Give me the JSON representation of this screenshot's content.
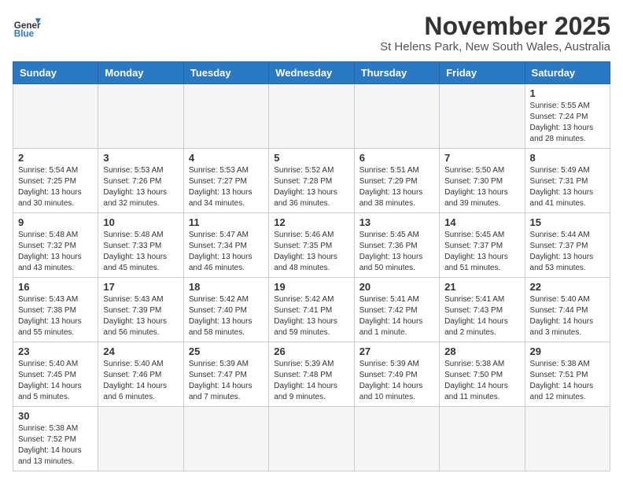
{
  "logo": {
    "text_general": "General",
    "text_blue": "Blue"
  },
  "title": "November 2025",
  "location": "St Helens Park, New South Wales, Australia",
  "weekdays": [
    "Sunday",
    "Monday",
    "Tuesday",
    "Wednesday",
    "Thursday",
    "Friday",
    "Saturday"
  ],
  "weeks": [
    [
      {
        "day": "",
        "info": ""
      },
      {
        "day": "",
        "info": ""
      },
      {
        "day": "",
        "info": ""
      },
      {
        "day": "",
        "info": ""
      },
      {
        "day": "",
        "info": ""
      },
      {
        "day": "",
        "info": ""
      },
      {
        "day": "1",
        "info": "Sunrise: 5:55 AM\nSunset: 7:24 PM\nDaylight: 13 hours\nand 28 minutes."
      }
    ],
    [
      {
        "day": "2",
        "info": "Sunrise: 5:54 AM\nSunset: 7:25 PM\nDaylight: 13 hours\nand 30 minutes."
      },
      {
        "day": "3",
        "info": "Sunrise: 5:53 AM\nSunset: 7:26 PM\nDaylight: 13 hours\nand 32 minutes."
      },
      {
        "day": "4",
        "info": "Sunrise: 5:53 AM\nSunset: 7:27 PM\nDaylight: 13 hours\nand 34 minutes."
      },
      {
        "day": "5",
        "info": "Sunrise: 5:52 AM\nSunset: 7:28 PM\nDaylight: 13 hours\nand 36 minutes."
      },
      {
        "day": "6",
        "info": "Sunrise: 5:51 AM\nSunset: 7:29 PM\nDaylight: 13 hours\nand 38 minutes."
      },
      {
        "day": "7",
        "info": "Sunrise: 5:50 AM\nSunset: 7:30 PM\nDaylight: 13 hours\nand 39 minutes."
      },
      {
        "day": "8",
        "info": "Sunrise: 5:49 AM\nSunset: 7:31 PM\nDaylight: 13 hours\nand 41 minutes."
      }
    ],
    [
      {
        "day": "9",
        "info": "Sunrise: 5:48 AM\nSunset: 7:32 PM\nDaylight: 13 hours\nand 43 minutes."
      },
      {
        "day": "10",
        "info": "Sunrise: 5:48 AM\nSunset: 7:33 PM\nDaylight: 13 hours\nand 45 minutes."
      },
      {
        "day": "11",
        "info": "Sunrise: 5:47 AM\nSunset: 7:34 PM\nDaylight: 13 hours\nand 46 minutes."
      },
      {
        "day": "12",
        "info": "Sunrise: 5:46 AM\nSunset: 7:35 PM\nDaylight: 13 hours\nand 48 minutes."
      },
      {
        "day": "13",
        "info": "Sunrise: 5:45 AM\nSunset: 7:36 PM\nDaylight: 13 hours\nand 50 minutes."
      },
      {
        "day": "14",
        "info": "Sunrise: 5:45 AM\nSunset: 7:37 PM\nDaylight: 13 hours\nand 51 minutes."
      },
      {
        "day": "15",
        "info": "Sunrise: 5:44 AM\nSunset: 7:37 PM\nDaylight: 13 hours\nand 53 minutes."
      }
    ],
    [
      {
        "day": "16",
        "info": "Sunrise: 5:43 AM\nSunset: 7:38 PM\nDaylight: 13 hours\nand 55 minutes."
      },
      {
        "day": "17",
        "info": "Sunrise: 5:43 AM\nSunset: 7:39 PM\nDaylight: 13 hours\nand 56 minutes."
      },
      {
        "day": "18",
        "info": "Sunrise: 5:42 AM\nSunset: 7:40 PM\nDaylight: 13 hours\nand 58 minutes."
      },
      {
        "day": "19",
        "info": "Sunrise: 5:42 AM\nSunset: 7:41 PM\nDaylight: 13 hours\nand 59 minutes."
      },
      {
        "day": "20",
        "info": "Sunrise: 5:41 AM\nSunset: 7:42 PM\nDaylight: 14 hours\nand 1 minute."
      },
      {
        "day": "21",
        "info": "Sunrise: 5:41 AM\nSunset: 7:43 PM\nDaylight: 14 hours\nand 2 minutes."
      },
      {
        "day": "22",
        "info": "Sunrise: 5:40 AM\nSunset: 7:44 PM\nDaylight: 14 hours\nand 3 minutes."
      }
    ],
    [
      {
        "day": "23",
        "info": "Sunrise: 5:40 AM\nSunset: 7:45 PM\nDaylight: 14 hours\nand 5 minutes."
      },
      {
        "day": "24",
        "info": "Sunrise: 5:40 AM\nSunset: 7:46 PM\nDaylight: 14 hours\nand 6 minutes."
      },
      {
        "day": "25",
        "info": "Sunrise: 5:39 AM\nSunset: 7:47 PM\nDaylight: 14 hours\nand 7 minutes."
      },
      {
        "day": "26",
        "info": "Sunrise: 5:39 AM\nSunset: 7:48 PM\nDaylight: 14 hours\nand 9 minutes."
      },
      {
        "day": "27",
        "info": "Sunrise: 5:39 AM\nSunset: 7:49 PM\nDaylight: 14 hours\nand 10 minutes."
      },
      {
        "day": "28",
        "info": "Sunrise: 5:38 AM\nSunset: 7:50 PM\nDaylight: 14 hours\nand 11 minutes."
      },
      {
        "day": "29",
        "info": "Sunrise: 5:38 AM\nSunset: 7:51 PM\nDaylight: 14 hours\nand 12 minutes."
      }
    ],
    [
      {
        "day": "30",
        "info": "Sunrise: 5:38 AM\nSunset: 7:52 PM\nDaylight: 14 hours\nand 13 minutes."
      },
      {
        "day": "",
        "info": ""
      },
      {
        "day": "",
        "info": ""
      },
      {
        "day": "",
        "info": ""
      },
      {
        "day": "",
        "info": ""
      },
      {
        "day": "",
        "info": ""
      },
      {
        "day": "",
        "info": ""
      }
    ]
  ]
}
